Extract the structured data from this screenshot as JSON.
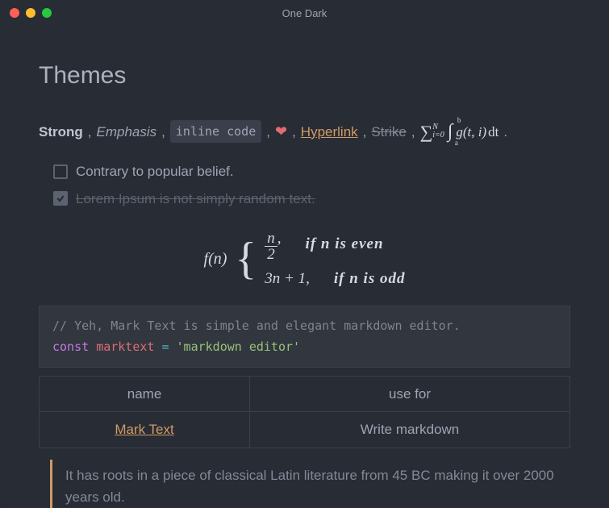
{
  "window": {
    "title": "One Dark"
  },
  "heading": "Themes",
  "formats": {
    "strong": "Strong",
    "emphasis": "Emphasis",
    "inline_code": "inline code",
    "heart_icon": "heart-icon",
    "hyperlink": "Hyperlink",
    "strike": "Strike",
    "sep": ",",
    "period": "."
  },
  "math_inline": {
    "sum_lower": "i=0",
    "sum_upper": "N",
    "int_lower": "a",
    "int_upper": "b",
    "fn": "g(t, i)",
    "dt": "dt"
  },
  "tasks": [
    {
      "checked": false,
      "text": "Contrary to popular belief."
    },
    {
      "checked": true,
      "text": "Lorem Ipsum is not simply random text."
    }
  ],
  "math_block": {
    "fn": "f(n)",
    "case1_num": "n",
    "case1_den": "2",
    "case1_cond": "if n is even",
    "case2_expr": "3n + 1,",
    "case2_cond": "if n is odd"
  },
  "code": {
    "comment": "// Yeh, Mark Text is simple and elegant markdown editor.",
    "kw": "const",
    "var": "marktext",
    "op": "=",
    "str": "'markdown editor'"
  },
  "table": {
    "headers": [
      "name",
      "use for"
    ],
    "row": {
      "name": "Mark Text",
      "use": "Write markdown"
    }
  },
  "quote": "It has roots in a piece of classical Latin literature from 45 BC making it over 2000 years old."
}
